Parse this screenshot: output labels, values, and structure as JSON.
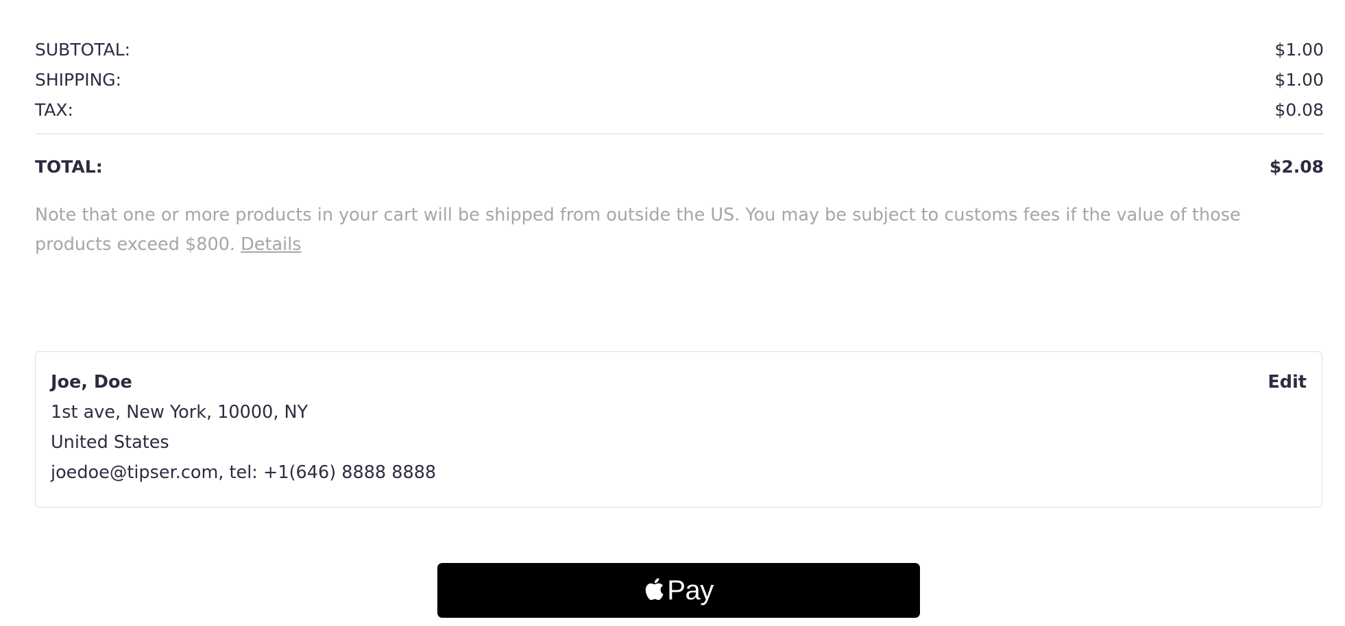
{
  "summary": {
    "subtotal": {
      "label": "SUBTOTAL:",
      "value": "$1.00"
    },
    "shipping": {
      "label": "SHIPPING:",
      "value": "$1.00"
    },
    "tax": {
      "label": "TAX:",
      "value": "$0.08"
    },
    "total": {
      "label": "TOTAL:",
      "value": "$2.08"
    }
  },
  "note": {
    "text": "Note that one or more products in your cart will be shipped from outside the US. You may be subject to customs fees if the value of those products exceed $800.",
    "link_label": "Details"
  },
  "address": {
    "name": "Joe, Doe",
    "street": "1st ave, New York, 10000, NY",
    "country": "United States",
    "contact": "joedoe@tipser.com, tel: +1(646) 8888 8888",
    "edit_label": "Edit"
  },
  "payment": {
    "button_label": "Pay",
    "icon": "apple-logo-icon"
  }
}
